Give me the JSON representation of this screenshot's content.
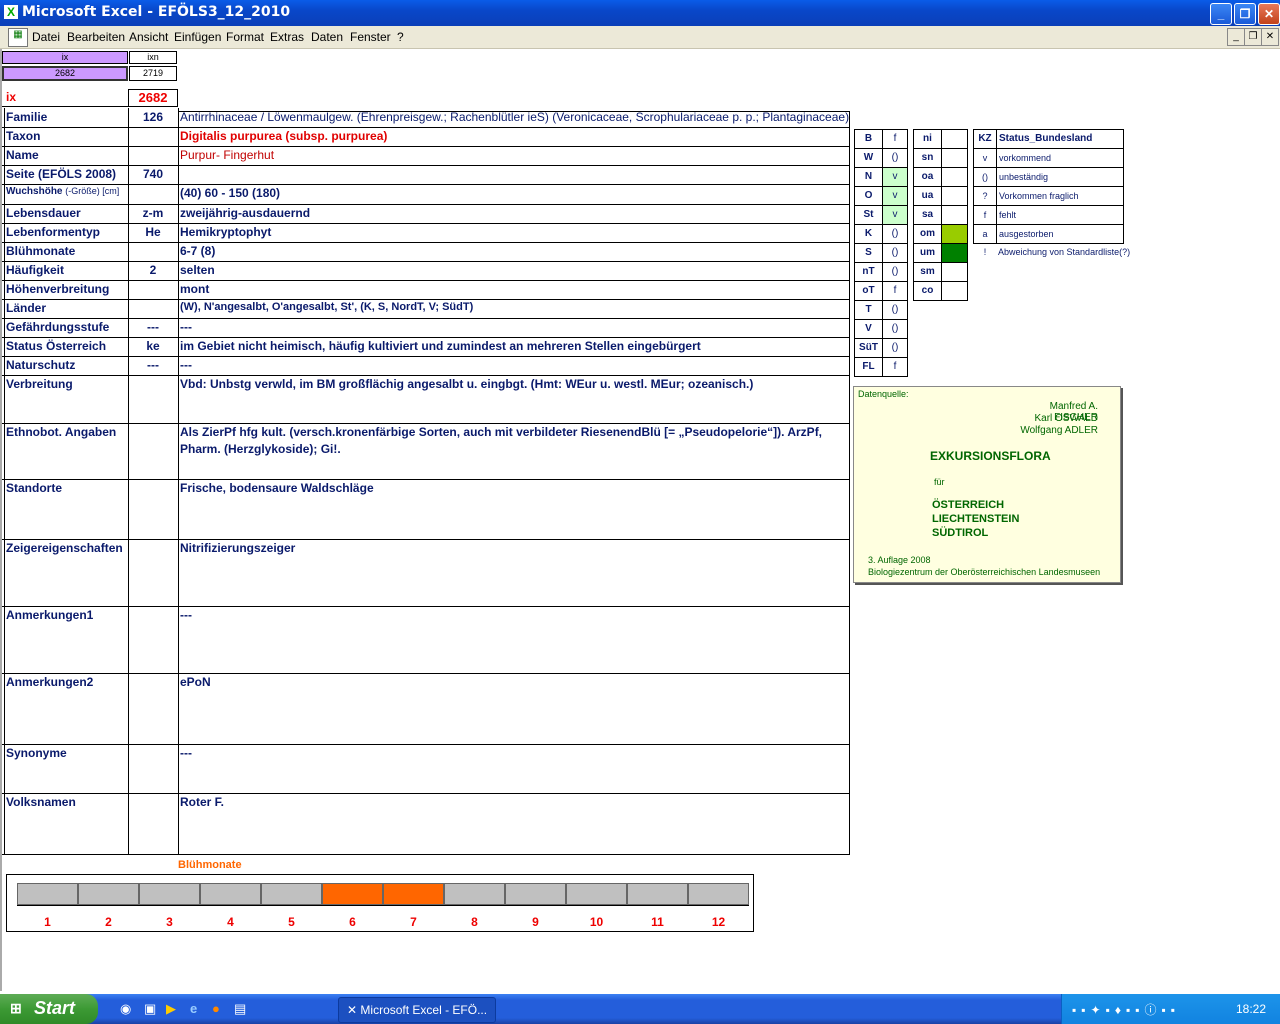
{
  "window": {
    "title": "Microsoft Excel - EFÖLS3_12_2010"
  },
  "menu": [
    "Datei",
    "Bearbeiten",
    "Ansicht",
    "Einfügen",
    "Format",
    "Extras",
    "Daten",
    "Fenster",
    "?"
  ],
  "top": {
    "h1": "ix",
    "h2": "ixn",
    "v1": "2682",
    "v2": "2719",
    "ix_label": "ix",
    "ix_value": "2682"
  },
  "rows": [
    {
      "label": "Familie",
      "num": "126",
      "value": "Antirrhinaceae  /  Löwenmaulgew. (Ehrenpreisgew.; Rachenblütler ieS) (Veronicaceae, Scrophulariaceae p. p.; Plantaginaceae)"
    },
    {
      "label": "Taxon",
      "num": "",
      "value": "Digitalis purpurea (subsp. purpurea)"
    },
    {
      "label": "Name",
      "num": "",
      "value": "Purpur- Fingerhut"
    },
    {
      "label": "Seite (EFÖLS 2008)",
      "num": "740",
      "value": ""
    },
    {
      "label": "Wuchshöhe",
      "label_small": "(-Größe) [cm]",
      "num": "",
      "value": "(40) 60 - 150 (180)"
    },
    {
      "label": "Lebensdauer",
      "num": "z-m",
      "value": "zweijährig-ausdauernd"
    },
    {
      "label": "Lebenformentyp",
      "num": "He",
      "value": "Hemikryptophyt"
    },
    {
      "label": "Blühmonate",
      "num": "",
      "value": " 6-7 (8)"
    },
    {
      "label": "Häufigkeit",
      "num": "2",
      "value": "selten"
    },
    {
      "label": "Höhenverbreitung",
      "num": "",
      "value": "mont"
    },
    {
      "label": "Länder",
      "num": "",
      "value": "(W), N'angesalbt, O'angesalbt, St', (K, S, NordT, V; SüdT)"
    },
    {
      "label": "Gefährdungsstufe",
      "num": "---",
      "value": "  ---"
    },
    {
      "label": "Status Österreich",
      "num": "ke",
      "value": "im Gebiet nicht heimisch, häufig kultiviert und zumindest an mehreren Stellen eingebürgert"
    },
    {
      "label": "Naturschutz",
      "num": "---",
      "value": " ---"
    }
  ],
  "bigrows": [
    {
      "label": "Verbreitung",
      "value": "Vbd:  Unbstg verwld, im BM großflächig angesalbt u. eingbgt. (Hmt: WEur u. westl. MEur; ozeanisch.)",
      "value2": ""
    },
    {
      "label": "Ethnobot. Angaben",
      "value": "Als ZierPf hfg kult. (versch.kronenfärbige Sorten, auch mit verbildeter RiesenendBlü [= „Pseudopelorie“]). ArzPf,",
      "value2": "Pharm. (Herzglykoside); Gi!."
    },
    {
      "label": "Standorte",
      "value": "Frische, bodensaure Waldschläge",
      "value2": ""
    },
    {
      "label": "Zeigereigenschaften",
      "value": "Nitrifizierungszeiger",
      "value2": ""
    },
    {
      "label": "Anmerkungen1",
      "value": "---",
      "value2": ""
    },
    {
      "label": "Anmerkungen2",
      "value": "ePoN",
      "value2": ""
    },
    {
      "label": "Synonyme",
      "value": "---",
      "value2": ""
    },
    {
      "label": "Volksnamen",
      "value": "Roter F.",
      "value2": ""
    }
  ],
  "states": [
    {
      "k": "B",
      "v": "f"
    },
    {
      "k": "W",
      "v": "()"
    },
    {
      "k": "N",
      "v": "v"
    },
    {
      "k": "O",
      "v": "v"
    },
    {
      "k": "St",
      "v": "v"
    },
    {
      "k": "K",
      "v": "()"
    },
    {
      "k": "S",
      "v": "()"
    },
    {
      "k": "nT",
      "v": "()"
    },
    {
      "k": "oT",
      "v": "f"
    },
    {
      "k": "T",
      "v": "()"
    },
    {
      "k": "V",
      "v": "()"
    },
    {
      "k": "SüT",
      "v": "()"
    },
    {
      "k": "FL",
      "v": "f"
    }
  ],
  "zones": [
    {
      "k": "ni",
      "fill": ""
    },
    {
      "k": "sn",
      "fill": ""
    },
    {
      "k": "oa",
      "fill": ""
    },
    {
      "k": "ua",
      "fill": ""
    },
    {
      "k": "sa",
      "fill": ""
    },
    {
      "k": "om",
      "fill": "#99cc00"
    },
    {
      "k": "um",
      "fill": "#008000"
    },
    {
      "k": "sm",
      "fill": ""
    },
    {
      "k": "co",
      "fill": ""
    }
  ],
  "kz": {
    "header_k": "KZ",
    "header_v": "Status_Bundesland",
    "items": [
      {
        "k": "v",
        "v": "vorkommend"
      },
      {
        "k": "()",
        "v": "unbeständig"
      },
      {
        "k": "?",
        "v": "Vorkommen fraglich"
      },
      {
        "k": "f",
        "v": "fehlt"
      },
      {
        "k": "a",
        "v": "ausgestorben"
      },
      {
        "k": "!",
        "v": "Abweichung von Standardliste(?)"
      }
    ]
  },
  "source": {
    "label": "Datenquelle:",
    "authors": [
      "Manfred A. FISCHER",
      "Karl OSWALD",
      "Wolfgang ADLER"
    ],
    "title": "EXKURSIONSFLORA",
    "fuer": "für",
    "countries": [
      "ÖSTERREICH",
      "LIECHTENSTEIN",
      "SÜDTIROL"
    ],
    "edition": "3. Auflage 2008",
    "publisher": "Biologiezentrum der Oberösterreichischen Landesmuseen"
  },
  "bloom": {
    "title": "Blühmonate",
    "months": [
      "1",
      "2",
      "3",
      "4",
      "5",
      "6",
      "7",
      "8",
      "9",
      "10",
      "11",
      "12"
    ],
    "active": [
      6,
      7
    ],
    "colors": {
      "active": "#ff6600",
      "inactive": "#c0c0c0"
    }
  },
  "taskbar": {
    "start": "Start",
    "task": "Microsoft Excel - EFÖ...",
    "clock": "18:22"
  }
}
